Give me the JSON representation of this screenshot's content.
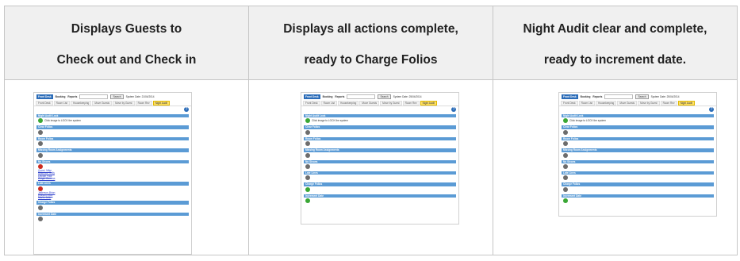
{
  "headers": [
    [
      "Displays Guests to",
      "Check out and Check in"
    ],
    [
      "Displays all actions complete,",
      "ready to Charge Folios"
    ],
    [
      "Night Audit clear and complete,",
      "ready to increment date."
    ]
  ],
  "thumbs": [
    {
      "date": "System Date: 21/04/2014",
      "sections": [
        {
          "title": "Night Audit Lock",
          "icon": "green",
          "text": "Click image to LOCK the system"
        },
        {
          "title": "Clear Folios",
          "icon": "grey"
        },
        {
          "title": "Room Folios",
          "icon": "grey"
        },
        {
          "title": "Missing Room Assignments",
          "icon": "grey"
        },
        {
          "title": "No Shows",
          "icon": "red",
          "links": [
            "Guest, Mike",
            "Blakeson Kelly",
            "Lincoln Paul",
            "Wright Gemma"
          ]
        },
        {
          "title": "Late Lines",
          "icon": "red",
          "links": [
            "Jefferson Brian",
            "Williams Bob",
            "Martin Julie"
          ]
        },
        {
          "title": "Charge Folios",
          "icon": "grey"
        },
        {
          "title": "Increment Date",
          "icon": "grey"
        }
      ]
    },
    {
      "date": "System Date: 25/04/2014",
      "sections": [
        {
          "title": "Night Audit Lock",
          "icon": "green",
          "text": "Click image to LOCK the system"
        },
        {
          "title": "Clear Folios",
          "icon": "grey"
        },
        {
          "title": "Room Folios",
          "icon": "grey"
        },
        {
          "title": "Missing Room Assignments",
          "icon": "grey"
        },
        {
          "title": "No Shows",
          "icon": "grey"
        },
        {
          "title": "Late Lines",
          "icon": "grey"
        },
        {
          "title": "Charge Folios",
          "icon": "green"
        },
        {
          "title": "Increment Date",
          "icon": "green"
        }
      ]
    },
    {
      "date": "System Date: 25/04/2014",
      "sections": [
        {
          "title": "Night Audit Lock",
          "icon": "green",
          "text": "Click image to LOCK the system"
        },
        {
          "title": "Clear Folios",
          "icon": "grey"
        },
        {
          "title": "Room Folios",
          "icon": "grey"
        },
        {
          "title": "Missing Room Assignments",
          "icon": "grey"
        },
        {
          "title": "No Shows",
          "icon": "grey"
        },
        {
          "title": "Late Lines",
          "icon": "grey"
        },
        {
          "title": "Charge Folios",
          "icon": "grey"
        },
        {
          "title": "Increment Date",
          "icon": "green"
        }
      ]
    }
  ],
  "topnav": {
    "front_desk": "Front Desk",
    "booking": "Booking",
    "reports": "Reports",
    "search_button": "Search"
  },
  "tabs": [
    "Front Desk",
    "Room List",
    "Housekeeping",
    "Move Guests",
    "Move by Guest",
    "Room Rev",
    "Night Audit"
  ],
  "colors": {
    "bar": "#5b9bd5",
    "brand": "#2b6cb8",
    "active_tab": "#ffe26b",
    "icon_green": "#3aa735",
    "icon_grey": "#6d6d6d",
    "icon_red": "#cc2b1f"
  }
}
